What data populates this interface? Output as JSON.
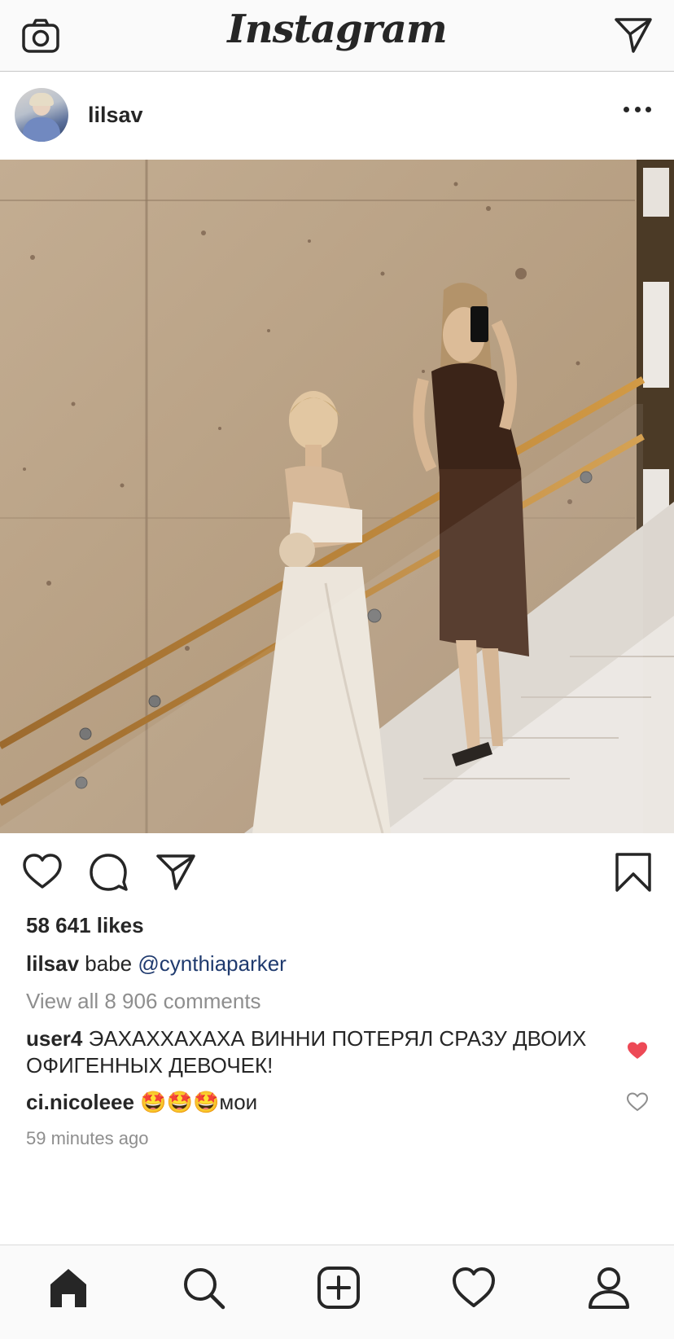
{
  "app": {
    "title": "Instagram"
  },
  "icons": {
    "camera": "camera-icon",
    "direct": "paper-plane-icon",
    "more": "more-horizontal-icon",
    "like": "heart-outline-icon",
    "comment": "comment-bubble-icon",
    "share": "paper-plane-icon",
    "save": "bookmark-icon",
    "liked": "heart-filled-icon",
    "home": "home-icon",
    "search": "search-icon",
    "new_post": "plus-square-icon",
    "activity": "heart-outline-icon",
    "profile": "person-icon"
  },
  "post": {
    "username": "lilsav",
    "likes": "58 641 likes",
    "caption": {
      "username": "lilsav",
      "text": "babe",
      "mention": "@cynthiaparker"
    },
    "view_all_comments": "View all 8 906 comments",
    "comments": [
      {
        "username": "user4",
        "text": "ЭАХАХХАХАХА ВИННИ ПОТЕРЯЛ СРАЗУ ДВОИХ ОФИГЕННЫХ ДЕВОЧЕК!",
        "liked": true
      },
      {
        "username": "ci.nicoleee",
        "text": "🤩🤩🤩мои",
        "liked": false
      }
    ],
    "timestamp": "59 minutes ago"
  },
  "colors": {
    "liked_heart": "#ed4956",
    "mention": "#1f3a6e",
    "secondary_text": "#8e8e8e"
  }
}
